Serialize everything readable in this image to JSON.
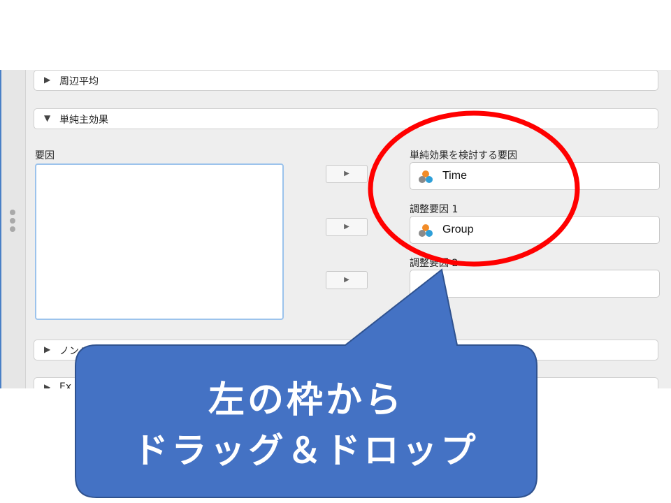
{
  "sections": {
    "marginal_means": "周辺平均",
    "simple_effects": "単純主効果",
    "nonparam": "ノンパ",
    "extra": "Ex"
  },
  "factors": {
    "label": "要因"
  },
  "targets": {
    "simple_effect_factor": {
      "label": "単純効果を検討する要因",
      "value": "Time"
    },
    "moderator1": {
      "label": "調整要因 1",
      "value": "Group"
    },
    "moderator2": {
      "label": "調整要因 2",
      "value": ""
    }
  },
  "buttons": {
    "move_arrow": "▶"
  },
  "callout": {
    "line1": "左の枠から",
    "line2": "ドラッグ＆ドロップ",
    "fill_color": "#4472c4",
    "border_color": "#2f528f"
  },
  "highlight": {
    "color": "#ff0000"
  },
  "icons": {
    "expand": "▶",
    "collapse": "▼",
    "variable": "nominal-variable-icon",
    "sidebar_handle": "drag-handle-icon"
  }
}
